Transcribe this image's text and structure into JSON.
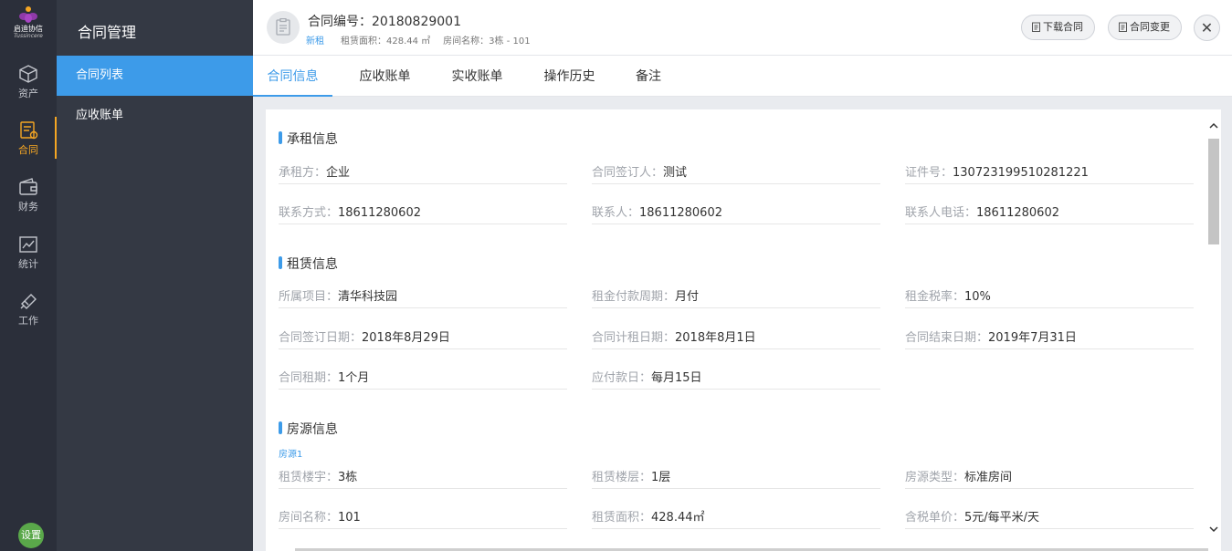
{
  "brand": {
    "name": "启迪协信",
    "sub": "Tussincere"
  },
  "rail": [
    {
      "label": "资产",
      "icon": "cube-icon"
    },
    {
      "label": "合同",
      "icon": "contract-icon"
    },
    {
      "label": "财务",
      "icon": "wallet-icon"
    },
    {
      "label": "统计",
      "icon": "chart-icon"
    },
    {
      "label": "工作",
      "icon": "tools-icon"
    }
  ],
  "settings_label": "设置",
  "subnav": {
    "title": "合同管理",
    "items": [
      {
        "label": "合同列表"
      },
      {
        "label": "应收账单"
      }
    ]
  },
  "header": {
    "contract_no_label": "合同编号：",
    "contract_no": "20180829001",
    "status_tag": "新租",
    "area_label": "租赁面积：",
    "area_value": "428.44 ㎡",
    "room_label": "房间名称：",
    "room_value": "3栋 - 101",
    "download_label": "下载合同",
    "change_label": "合同变更"
  },
  "tabs": [
    {
      "label": "合同信息"
    },
    {
      "label": "应收账单"
    },
    {
      "label": "实收账单"
    },
    {
      "label": "操作历史"
    },
    {
      "label": "备注"
    }
  ],
  "sections": {
    "tenant": {
      "title": "承租信息",
      "fields": [
        {
          "label": "承租方：",
          "value": "企业"
        },
        {
          "label": "合同签订人：",
          "value": "测试"
        },
        {
          "label": "证件号：",
          "value": "130723199510281221"
        },
        {
          "label": "联系方式：",
          "value": "18611280602"
        },
        {
          "label": "联系人：",
          "value": "18611280602"
        },
        {
          "label": "联系人电话：",
          "value": "18611280602"
        }
      ]
    },
    "lease": {
      "title": "租赁信息",
      "fields": [
        {
          "label": "所属项目：",
          "value": "清华科技园"
        },
        {
          "label": "租金付款周期：",
          "value": "月付"
        },
        {
          "label": "租金税率：",
          "value": "10%"
        },
        {
          "label": "合同签订日期：",
          "value": "2018年8月29日"
        },
        {
          "label": "合同计租日期：",
          "value": "2018年8月1日"
        },
        {
          "label": "合同结束日期：",
          "value": "2019年7月31日"
        },
        {
          "label": "合同租期：",
          "value": "1个月"
        },
        {
          "label": "应付款日：",
          "value": "每月15日"
        }
      ]
    },
    "property": {
      "title": "房源信息",
      "source_tag": "房源1",
      "fields": [
        {
          "label": "租赁楼宇：",
          "value": "3栋"
        },
        {
          "label": "租赁楼层：",
          "value": "1层"
        },
        {
          "label": "房源类型：",
          "value": "标准房间"
        },
        {
          "label": "房间名称：",
          "value": "101"
        },
        {
          "label": "租赁面积：",
          "value": "428.44㎡"
        },
        {
          "label": "含税单价：",
          "value": "5元/每平米/天"
        }
      ]
    }
  },
  "colors": {
    "accent": "#3d9be9",
    "rail_bg": "#2b2f3a",
    "subnav_bg": "#343944",
    "active_rail": "#f5a623"
  }
}
